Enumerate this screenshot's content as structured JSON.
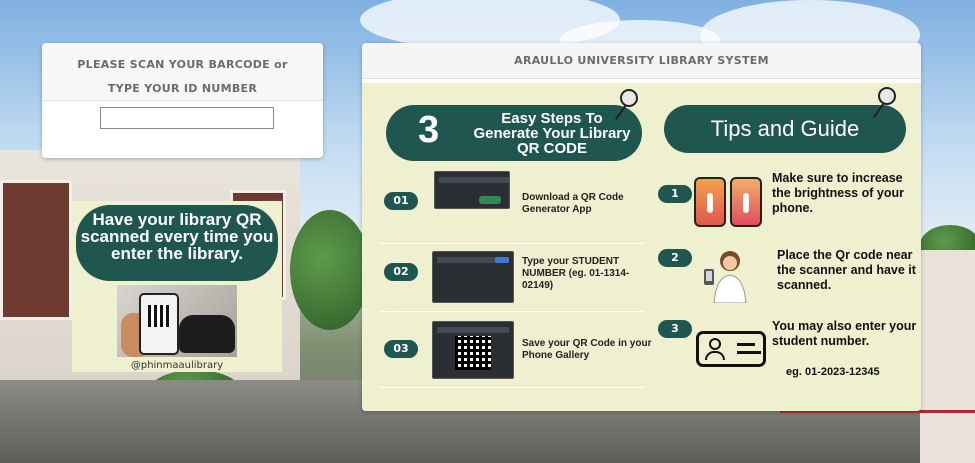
{
  "scan_panel": {
    "line1": "PLEASE SCAN YOUR BARCODE or",
    "line2": "TYPE YOUR ID NUMBER",
    "id_input_value": "",
    "id_input_placeholder": ""
  },
  "left_poster": {
    "headline": "Have your library QR scanned every time you enter the library.",
    "handle": "@phinmaaulibrary"
  },
  "main_panel": {
    "title": "ARAULLO UNIVERSITY LIBRARY SYSTEM",
    "steps_banner": {
      "number": "3",
      "text": "Easy Steps To Generate Your Library QR CODE"
    },
    "steps": [
      {
        "badge": "01",
        "text": "Download a QR Code Generator App"
      },
      {
        "badge": "02",
        "text": "Type your STUDENT NUMBER (eg. 01-1314-02149)"
      },
      {
        "badge": "03",
        "text": "Save your QR Code in your Phone Gallery"
      }
    ],
    "tips_banner": "Tips and Guide",
    "tips": [
      {
        "badge": "1",
        "text": "Make sure to increase the brightness of your phone."
      },
      {
        "badge": "2",
        "text": "Place the Qr code near the scanner and have it scanned."
      },
      {
        "badge": "3",
        "text": "You may also enter your student number.",
        "example": "eg. 01-2023-12345"
      }
    ]
  },
  "colors": {
    "banner_teal": "#1f5650",
    "poster_bg": "#eef0cf",
    "header_text": "#6b6b6b"
  }
}
